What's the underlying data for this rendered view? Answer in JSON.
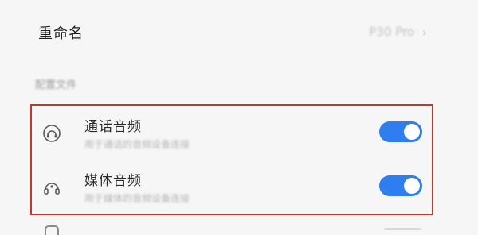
{
  "rename": {
    "label": "重命名",
    "value": "P30 Pro",
    "chevron": "›"
  },
  "section": {
    "title": "配置文件"
  },
  "profiles": [
    {
      "icon": "phone-headset-icon",
      "title": "通话音频",
      "subtitle": "用于通话的音频设备连接",
      "enabled": true
    },
    {
      "icon": "headphones-icon",
      "title": "媒体音频",
      "subtitle": "用于媒体的音频设备连接",
      "enabled": true
    }
  ],
  "colors": {
    "toggle_on": "#2f7ef0",
    "highlight_border": "#c0392b"
  }
}
